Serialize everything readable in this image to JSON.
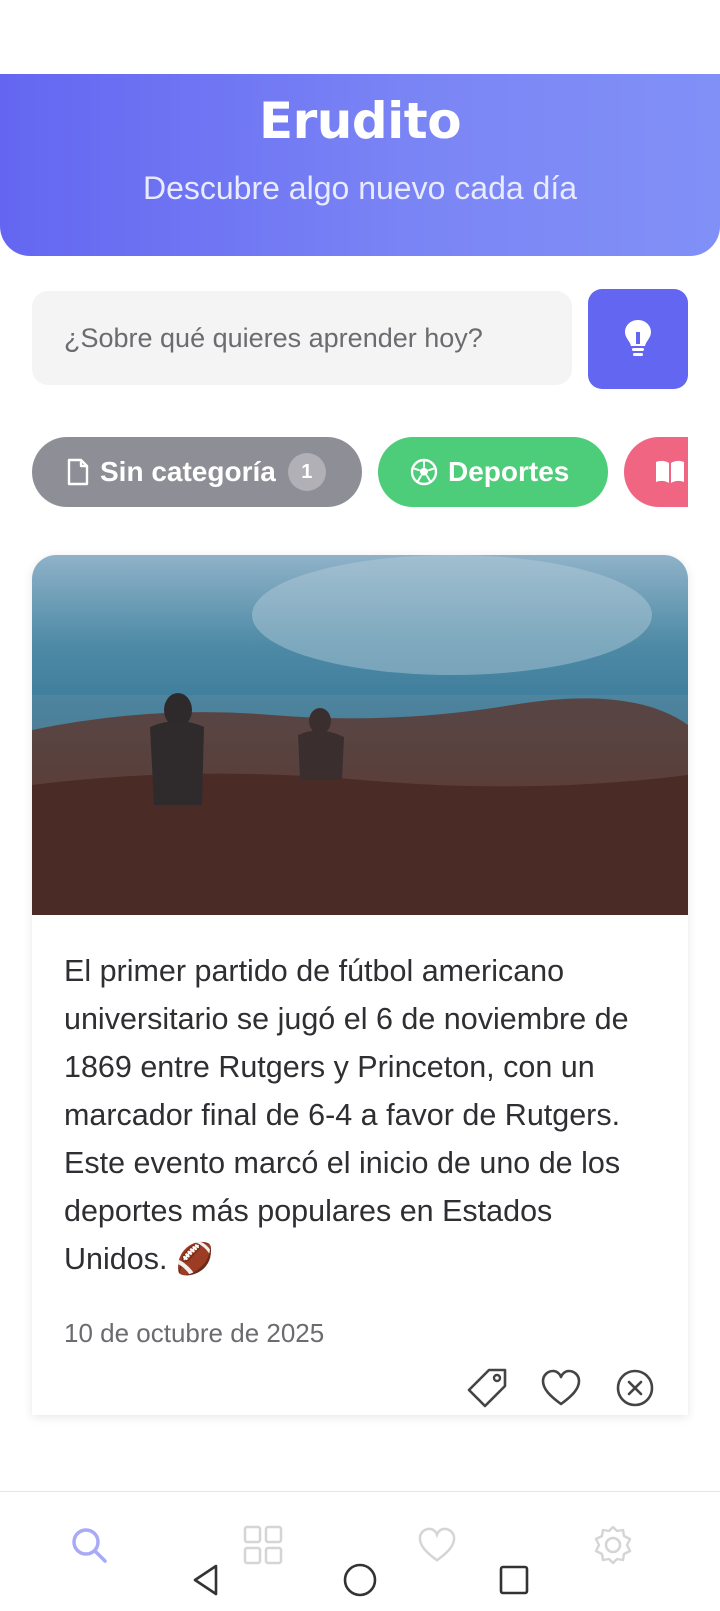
{
  "header": {
    "title": "Erudito",
    "subtitle": "Descubre algo nuevo cada día"
  },
  "search": {
    "placeholder": "¿Sobre qué quieres aprender hoy?",
    "value": "",
    "button_icon": "lightbulb-icon"
  },
  "categories": [
    {
      "label": "Sin categoría",
      "icon": "file-icon",
      "count": "1",
      "color": "#8e8e96"
    },
    {
      "label": "Deportes",
      "icon": "soccer-ball-icon",
      "color": "#4dcc7a"
    },
    {
      "label": "",
      "icon": "book-icon",
      "color": "#f06582"
    }
  ],
  "card": {
    "text": "El primer partido de fútbol americano universitario se jugó el 6 de noviembre de 1869 entre Rutgers y Princeton, con un marcador final de 6-4 a favor de Rutgers. Este evento marcó el inicio de uno de los deportes más populares en Estados Unidos. 🏈",
    "date": "10 de octubre de 2025",
    "actions": [
      "tag-icon",
      "heart-icon",
      "close-circle-icon"
    ]
  },
  "bottom_nav": [
    "search-icon",
    "grid-icon",
    "heart-icon",
    "settings-icon"
  ],
  "system_nav": [
    "back-icon",
    "home-icon",
    "recents-icon"
  ],
  "colors": {
    "accent": "#6366f1",
    "header_gradient_start": "#6466f1",
    "header_gradient_end": "#8190f7"
  }
}
